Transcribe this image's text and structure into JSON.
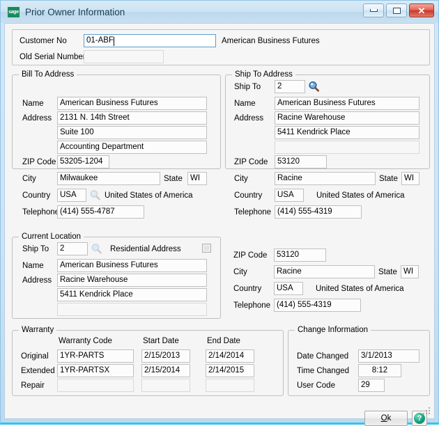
{
  "window": {
    "title": "Prior Owner Information",
    "logo_text": "sage",
    "minimize_label": "Minimize",
    "maximize_label": "Restore",
    "close_label": "Close"
  },
  "header": {
    "customer_no_label": "Customer No",
    "customer_no_value": "01-ABF",
    "customer_name": "American Business Futures",
    "old_serial_label": "Old Serial Number",
    "old_serial_value": ""
  },
  "bill_to": {
    "legend": "Bill To Address",
    "name_label": "Name",
    "name_value": "American Business Futures",
    "address_label": "Address",
    "address_line1": "2131 N. 14th Street",
    "address_line2": "Suite 100",
    "address_line3": "Accounting Department",
    "zip_label": "ZIP Code",
    "zip_value": "53205-1204",
    "city_label": "City",
    "city_value": "Milwaukee",
    "state_label": "State",
    "state_value": "WI",
    "country_label": "Country",
    "country_value": "USA",
    "country_name": "United States of America",
    "telephone_label": "Telephone",
    "telephone_value": "(414) 555-4787"
  },
  "ship_to": {
    "legend": "Ship To Address",
    "ship_to_label": "Ship To",
    "ship_to_value": "2",
    "name_label": "Name",
    "name_value": "American Business Futures",
    "address_label": "Address",
    "address_line1": "Racine Warehouse",
    "address_line2": "5411 Kendrick Place",
    "address_line3": "",
    "zip_label": "ZIP Code",
    "zip_value": "53120",
    "city_label": "City",
    "city_value": "Racine",
    "state_label": "State",
    "state_value": "WI",
    "country_label": "Country",
    "country_value": "USA",
    "country_name": "United States of America",
    "telephone_label": "Telephone",
    "telephone_value": "(414) 555-4319"
  },
  "current_location": {
    "legend": "Current Location",
    "ship_to_label": "Ship To",
    "ship_to_value": "2",
    "residential_label": "Residential Address",
    "residential_checked": false,
    "name_label": "Name",
    "name_value": "American Business Futures",
    "address_label": "Address",
    "address_line1": "Racine Warehouse",
    "address_line2": "5411 Kendrick Place",
    "address_line3": "",
    "zip_label": "ZIP Code",
    "zip_value": "53120",
    "city_label": "City",
    "city_value": "Racine",
    "state_label": "State",
    "state_value": "WI",
    "country_label": "Country",
    "country_value": "USA",
    "country_name": "United States of America",
    "telephone_label": "Telephone",
    "telephone_value": "(414) 555-4319"
  },
  "warranty": {
    "legend": "Warranty",
    "col_code": "Warranty Code",
    "col_start": "Start Date",
    "col_end": "End Date",
    "rows": [
      {
        "label": "Original",
        "code": "1YR-PARTS",
        "start": "2/15/2013",
        "end": "2/14/2014"
      },
      {
        "label": "Extended",
        "code": "1YR-PARTSX",
        "start": "2/15/2014",
        "end": "2/14/2015"
      },
      {
        "label": "Repair",
        "code": "",
        "start": "",
        "end": ""
      }
    ]
  },
  "change_info": {
    "legend": "Change Information",
    "date_changed_label": "Date Changed",
    "date_changed_value": "3/1/2013",
    "time_changed_label": "Time Changed",
    "time_changed_value": "8:12",
    "user_code_label": "User Code",
    "user_code_value": "29"
  },
  "footer": {
    "ok_prefix": "O",
    "ok_suffix": "k",
    "help_glyph": "?"
  },
  "icons": {
    "lookup": "magnifier-icon",
    "help": "question-icon"
  },
  "colors": {
    "accent": "#2ec6ef",
    "frame": "#cfe3f3",
    "sage_green": "#1a8a5f",
    "close_red": "#c8392c",
    "help_green": "#17a07a",
    "focus_blue": "#5d9ec9"
  }
}
